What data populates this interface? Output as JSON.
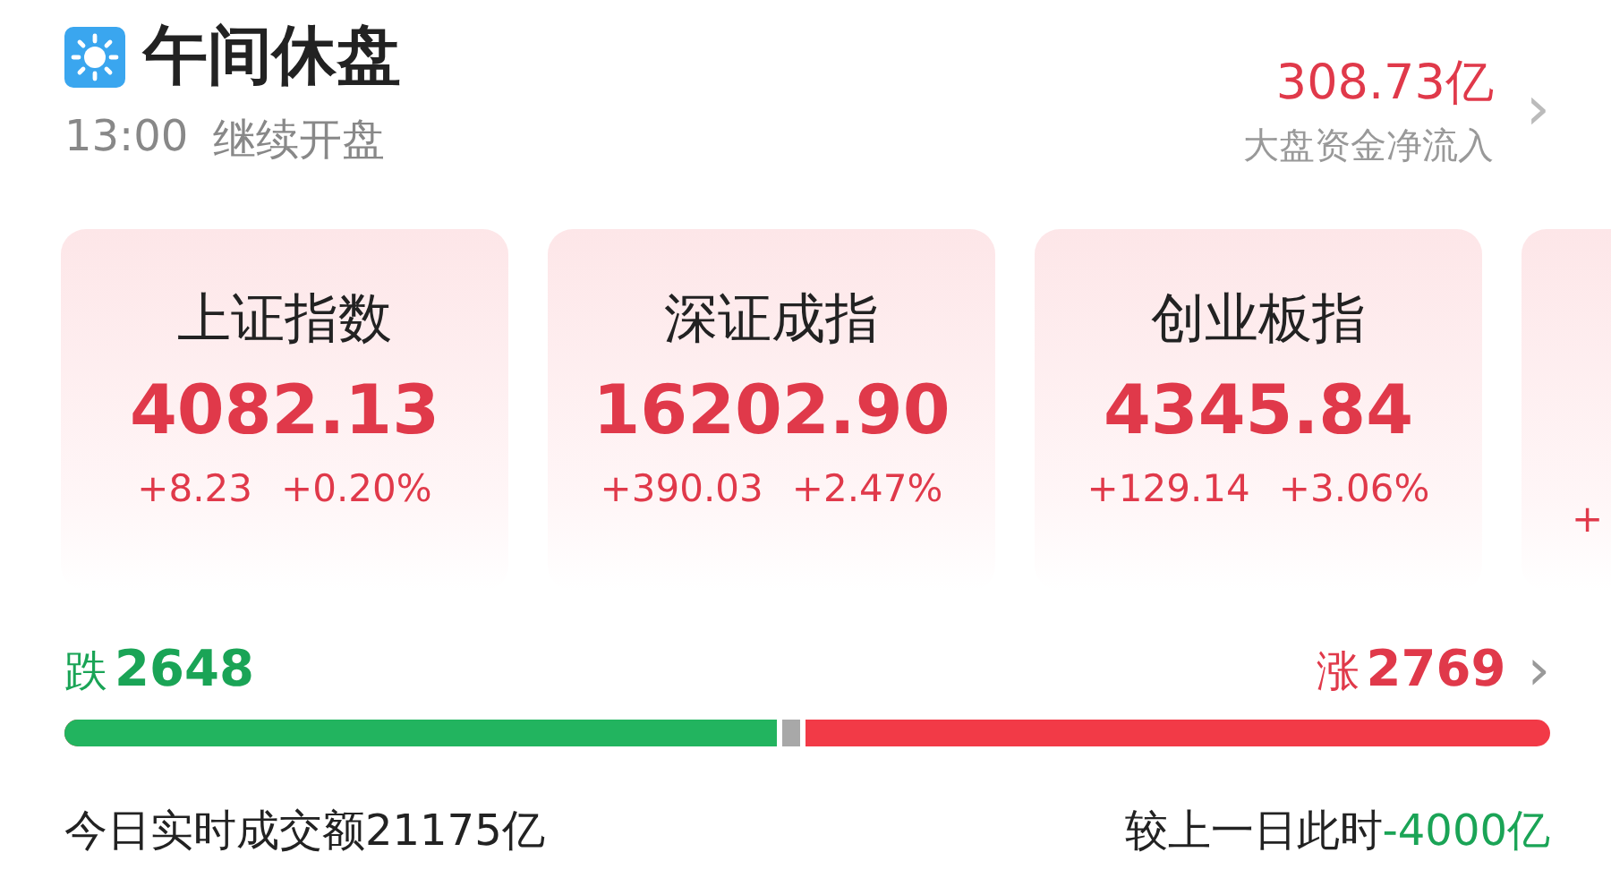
{
  "header": {
    "title": "午间休盘",
    "time": "13:00",
    "status": "继续开盘",
    "net_inflow": "308.73亿",
    "net_inflow_label": "大盘资金净流入",
    "chevron": "›"
  },
  "cards": [
    {
      "kind": "full",
      "name": "上证指数",
      "value": "4082.13",
      "change": "+8.23",
      "percent": "+0.20%"
    },
    {
      "kind": "full",
      "name": "深证成指",
      "value": "16202.90",
      "change": "+390.03",
      "percent": "+2.47%"
    },
    {
      "kind": "full",
      "name": "创业板指",
      "value": "4345.84",
      "change": "+129.14",
      "percent": "+3.06%"
    },
    {
      "kind": "partial",
      "change": "+"
    }
  ],
  "breadth": {
    "down_label": "跌",
    "down": "2648",
    "up_label": "涨",
    "up": "2769",
    "chevron": "›",
    "level": 0.48
  },
  "footer": {
    "turnover": "今日实时成交额21175亿",
    "compare_label": "较上一日此时",
    "compare_value": "-4000亿"
  }
}
